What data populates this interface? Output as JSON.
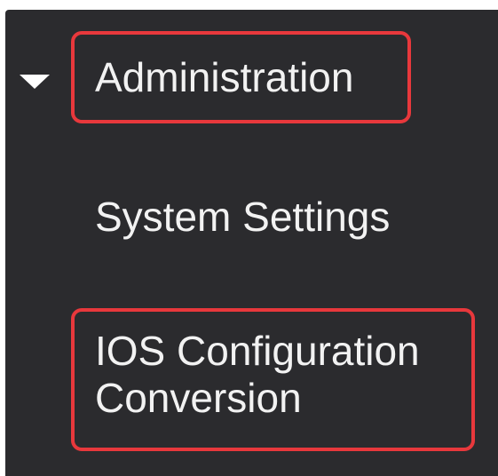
{
  "sidebar": {
    "section": {
      "label": "Administration",
      "expanded": true,
      "icon": "caret-down-icon"
    },
    "items": [
      {
        "label": "System Settings",
        "highlighted": false
      },
      {
        "label": "IOS Configuration Conversion",
        "highlighted": true
      }
    ]
  },
  "colors": {
    "background": "#2b2b2e",
    "text": "#f2f2f2",
    "highlight": "#e8383c"
  }
}
